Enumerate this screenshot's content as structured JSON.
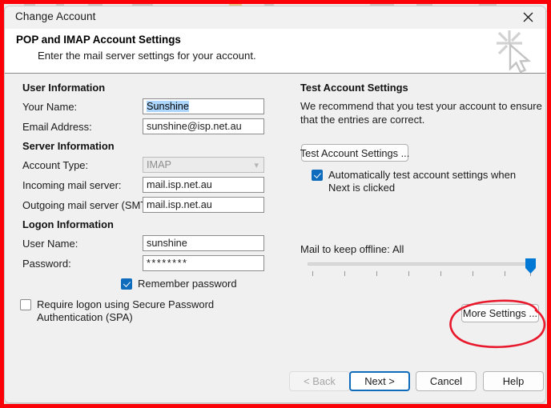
{
  "window": {
    "title": "Change Account",
    "close_icon": "close-icon",
    "wizard_icon": "wizard-cursor-sparkle-icon"
  },
  "header": {
    "title": "POP and IMAP Account Settings",
    "subtitle": "Enter the mail server settings for your account."
  },
  "left_column": {
    "user_information": {
      "section_title": "User Information",
      "your_name": {
        "label": "Your Name:",
        "value": "Sunshine",
        "selected": true
      },
      "email_address": {
        "label": "Email Address:",
        "value": "sunshine@isp.net.au"
      }
    },
    "server_information": {
      "section_title": "Server Information",
      "account_type": {
        "label": "Account Type:",
        "value": "IMAP",
        "disabled": true,
        "dropdown_icon": "chevron-down-icon"
      },
      "incoming_mail_server": {
        "label": "Incoming mail server:",
        "value": "mail.isp.net.au"
      },
      "outgoing_mail_server": {
        "label": "Outgoing mail server (SMTP):",
        "value": "mail.isp.net.au"
      }
    },
    "logon_information": {
      "section_title": "Logon Information",
      "user_name": {
        "label": "User Name:",
        "value": "sunshine"
      },
      "password": {
        "label": "Password:",
        "value": "********"
      },
      "remember_password": {
        "label": "Remember password",
        "checked": true
      },
      "require_spa": {
        "label": "Require logon using Secure Password Authentication (SPA)",
        "checked": false
      }
    }
  },
  "right_column": {
    "test_account_settings": {
      "section_title": "Test Account Settings",
      "description": "We recommend that you test your account to ensure that the entries are correct.",
      "button_label": "Test Account Settings ...",
      "auto_test": {
        "label": "Automatically test account settings when Next is clicked",
        "checked": true
      }
    },
    "mail_to_keep_offline": {
      "label": "Mail to keep offline:",
      "value": "All",
      "slider_position_percent": 100,
      "tick_count": 8
    },
    "more_settings_button": "More Settings ..."
  },
  "footer": {
    "back": "< Back",
    "next": "Next >",
    "cancel": "Cancel",
    "help": "Help"
  },
  "annotation": {
    "type": "hand-drawn-ellipse",
    "color": "#e8192c",
    "target": "More Settings ..."
  },
  "colors": {
    "accent": "#0f6cbd",
    "selection": "#add6ff",
    "annotation_red": "#e8192c",
    "frame_red": "#fb0007",
    "dialog_body": "#f0f0f0"
  }
}
